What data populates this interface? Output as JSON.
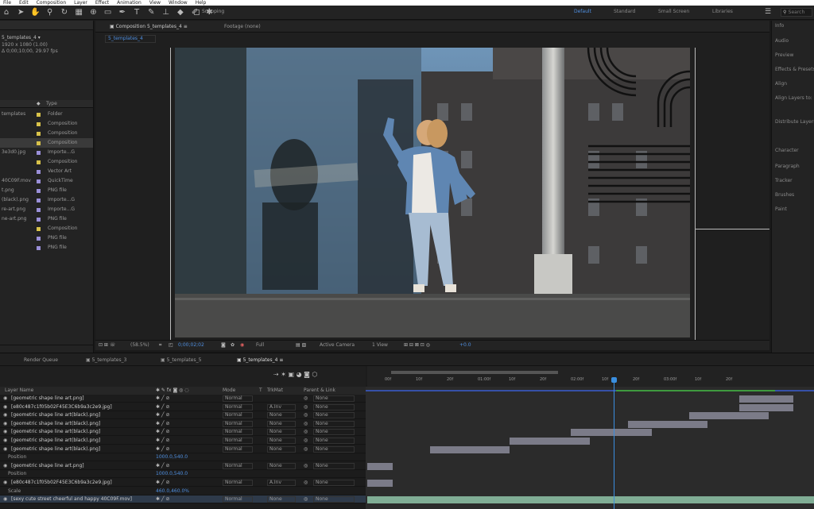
{
  "menu": [
    "File",
    "Edit",
    "Composition",
    "Layer",
    "Effect",
    "Animation",
    "View",
    "Window",
    "Help"
  ],
  "toolbar": {
    "snapping": "Snapping",
    "workspaces": [
      "Default",
      "Standard",
      "Small Screen",
      "Libraries"
    ],
    "search_placeholder": "Search"
  },
  "project": {
    "name": "templates_4",
    "meta1": "1920 x 1080 (1.00)",
    "meta2": "Δ 0;00;10;00, 29.97 fps",
    "type_header": "Type",
    "items": [
      {
        "name": "templates",
        "type": "Folder",
        "color": "#d8c24a"
      },
      {
        "name": "",
        "type": "Composition",
        "color": "#d8c24a"
      },
      {
        "name": "",
        "type": "Composition",
        "color": "#d8c24a"
      },
      {
        "name": "",
        "type": "Composition",
        "color": "#d8c24a"
      },
      {
        "name": "3e3d0.jpg",
        "type": "Importe...G",
        "color": "#9a8fd8"
      },
      {
        "name": "",
        "type": "Composition",
        "color": "#d8c24a"
      },
      {
        "name": "",
        "type": "Vector Art",
        "color": "#9a8fd8"
      },
      {
        "name": "40C09F.mov",
        "type": "QuickTime",
        "color": "#9a8fd8"
      },
      {
        "name": "t.png",
        "type": "PNG file",
        "color": "#9a8fd8"
      },
      {
        "name": "(black).png",
        "type": "Importe...G",
        "color": "#9a8fd8"
      },
      {
        "name": "re-art.png",
        "type": "Importe...G",
        "color": "#9a8fd8"
      },
      {
        "name": "ne-art.png",
        "type": "PNG file",
        "color": "#9a8fd8"
      },
      {
        "name": "",
        "type": "Composition",
        "color": "#d8c24a"
      },
      {
        "name": "",
        "type": "PNG file",
        "color": "#9a8fd8"
      },
      {
        "name": "",
        "type": "PNG file",
        "color": "#9a8fd8"
      }
    ]
  },
  "comp": {
    "tab": "Composition 5_templates_4",
    "footage": "Footage (none)",
    "sub_tab": "5_templates_4",
    "zoom": "(58.5%)",
    "timecode": "0;00;02;02",
    "resolution": "Full",
    "camera": "Active Camera",
    "views": "1 View",
    "exposure": "+0.0"
  },
  "right_panels": [
    "Info",
    "Audio",
    "Preview",
    "Effects & Presets",
    "Align",
    "Align Layers to:",
    "Distribute Layers",
    "Character",
    "Paragraph",
    "Tracker",
    "Brushes",
    "Paint"
  ],
  "timeline": {
    "tabs": [
      "Render Queue",
      "5_templates_3",
      "5_templates_5",
      "5_templates_4"
    ],
    "col_layer": "Layer Name",
    "col_mode": "Mode",
    "col_t": "T",
    "col_trkmat": "TrkMat",
    "col_parent": "Parent & Link",
    "ruler": [
      "00f",
      "10f",
      "20f",
      "01:00f",
      "10f",
      "20f",
      "02:00f",
      "10f",
      "20f",
      "03:00f",
      "10f",
      "20f"
    ],
    "layers": [
      {
        "name": "[geometric shape line art.png]",
        "mode": "Normal",
        "trk": "",
        "parent": "None",
        "bar": [
          930,
          998
        ]
      },
      {
        "name": "[e80c487c1f05b02F45E3C6b9a3c2e9.jpg]",
        "mode": "Normal",
        "trk": "A.Inv",
        "parent": "None",
        "bar": [
          930,
          998
        ]
      },
      {
        "name": "[geometric shape line art(black).png]",
        "mode": "Normal",
        "trk": "None",
        "parent": "None",
        "bar": [
          867,
          967
        ]
      },
      {
        "name": "[geometric shape line art(black).png]",
        "mode": "Normal",
        "trk": "None",
        "parent": "None",
        "bar": [
          790,
          890
        ]
      },
      {
        "name": "[geometric shape line art(black).png]",
        "mode": "Normal",
        "trk": "None",
        "parent": "None",
        "bar": [
          718,
          820
        ]
      },
      {
        "name": "[geometric shape line art(black).png]",
        "mode": "Normal",
        "trk": "None",
        "parent": "None",
        "bar": [
          641,
          742
        ]
      },
      {
        "name": "[geometric shape line art(black).png]",
        "mode": "Normal",
        "trk": "None",
        "parent": "None",
        "bar": [
          541,
          641
        ]
      },
      {
        "name": "Position",
        "sub": "1000.0,540.0",
        "mode": "",
        "trk": "",
        "parent": "",
        "bar": null
      },
      {
        "name": "[geometric shape line art.png]",
        "mode": "Normal",
        "trk": "None",
        "parent": "None",
        "bar": [
          462,
          494
        ]
      },
      {
        "name": "Position",
        "sub": "1000.0,540.0",
        "mode": "",
        "trk": "",
        "parent": "",
        "bar": null
      },
      {
        "name": "[e80c487c1f05b02F45E3C6b9a3c2e9.jpg]",
        "mode": "Normal",
        "trk": "A.Inv",
        "parent": "None",
        "bar": [
          462,
          494
        ]
      },
      {
        "name": "Scale",
        "sub": "460.0,460.0%",
        "mode": "",
        "trk": "",
        "parent": "",
        "bar": null
      },
      {
        "name": "[sexy cute street cheerful and happy 40C09F.mov]",
        "mode": "Normal",
        "trk": "None",
        "parent": "None",
        "bar": [
          462,
          1024
        ]
      }
    ]
  }
}
